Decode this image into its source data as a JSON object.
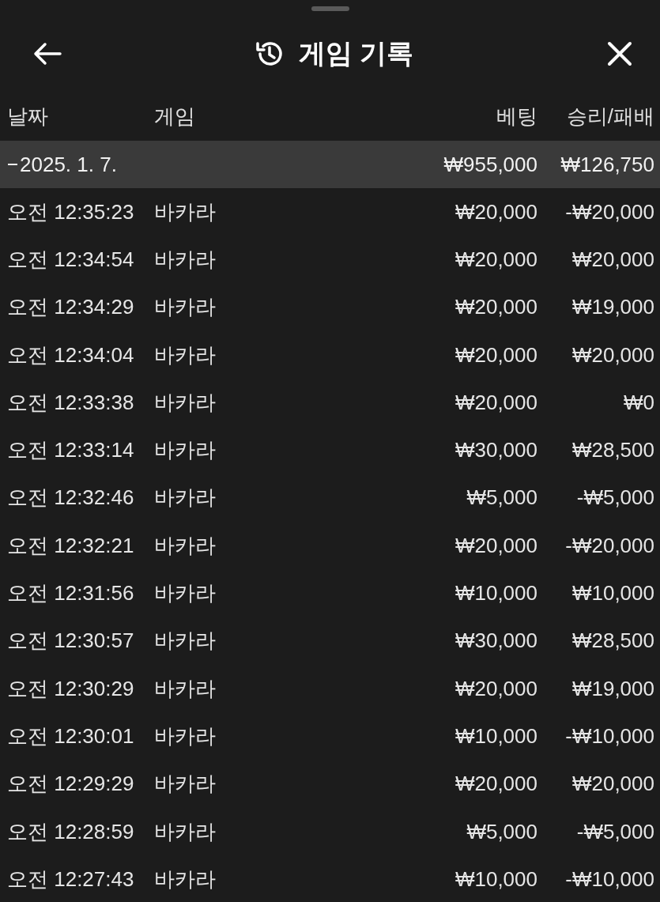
{
  "header": {
    "title": "게임 기록"
  },
  "columns": [
    "날짜",
    "게임",
    "베팅",
    "승리/패배"
  ],
  "group": {
    "date": "2025. 1. 7.",
    "expanded": true,
    "bet": "₩955,000",
    "result": "₩126,750"
  },
  "rows": [
    {
      "time": "오전 12:35:23",
      "game": "바카라",
      "bet": "₩20,000",
      "result": "-₩20,000"
    },
    {
      "time": "오전 12:34:54",
      "game": "바카라",
      "bet": "₩20,000",
      "result": "₩20,000"
    },
    {
      "time": "오전 12:34:29",
      "game": "바카라",
      "bet": "₩20,000",
      "result": "₩19,000"
    },
    {
      "time": "오전 12:34:04",
      "game": "바카라",
      "bet": "₩20,000",
      "result": "₩20,000"
    },
    {
      "time": "오전 12:33:38",
      "game": "바카라",
      "bet": "₩20,000",
      "result": "₩0"
    },
    {
      "time": "오전 12:33:14",
      "game": "바카라",
      "bet": "₩30,000",
      "result": "₩28,500"
    },
    {
      "time": "오전 12:32:46",
      "game": "바카라",
      "bet": "₩5,000",
      "result": "-₩5,000"
    },
    {
      "time": "오전 12:32:21",
      "game": "바카라",
      "bet": "₩20,000",
      "result": "-₩20,000"
    },
    {
      "time": "오전 12:31:56",
      "game": "바카라",
      "bet": "₩10,000",
      "result": "₩10,000"
    },
    {
      "time": "오전 12:30:57",
      "game": "바카라",
      "bet": "₩30,000",
      "result": "₩28,500"
    },
    {
      "time": "오전 12:30:29",
      "game": "바카라",
      "bet": "₩20,000",
      "result": "₩19,000"
    },
    {
      "time": "오전 12:30:01",
      "game": "바카라",
      "bet": "₩10,000",
      "result": "-₩10,000"
    },
    {
      "time": "오전 12:29:29",
      "game": "바카라",
      "bet": "₩20,000",
      "result": "₩20,000"
    },
    {
      "time": "오전 12:28:59",
      "game": "바카라",
      "bet": "₩5,000",
      "result": "-₩5,000"
    },
    {
      "time": "오전 12:27:43",
      "game": "바카라",
      "bet": "₩10,000",
      "result": "-₩10,000"
    }
  ]
}
